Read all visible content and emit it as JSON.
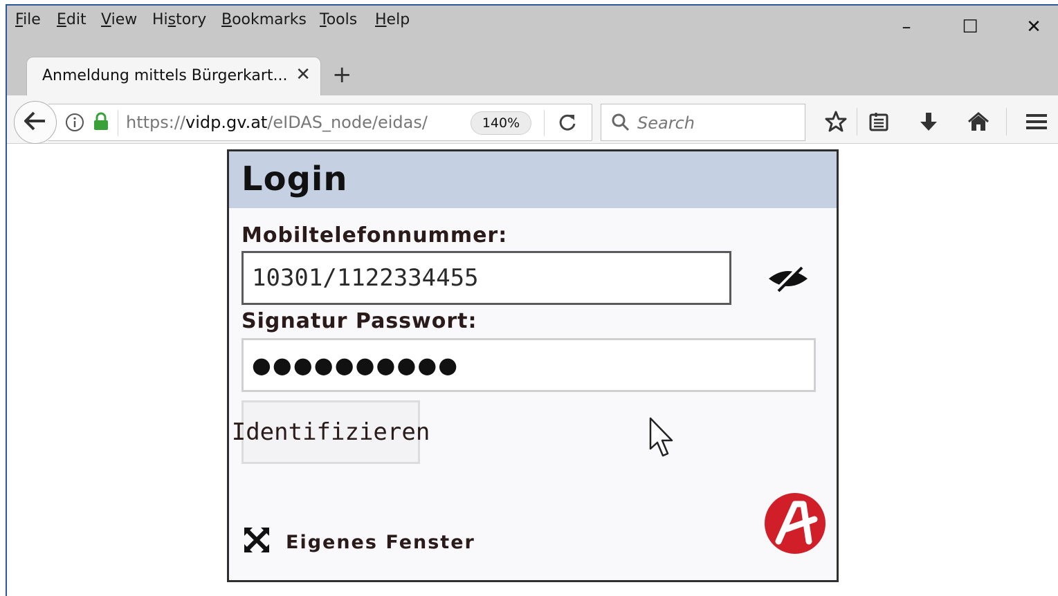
{
  "menubar": {
    "items": [
      {
        "label": "File",
        "accel": "F",
        "rest": "ile"
      },
      {
        "label": "Edit",
        "accel": "E",
        "rest": "dit"
      },
      {
        "label": "View",
        "accel": "V",
        "rest": "iew"
      },
      {
        "label": "History",
        "pre": "Hi",
        "accel": "s",
        "rest": "tory"
      },
      {
        "label": "Bookmarks",
        "accel": "B",
        "rest": "ookmarks"
      },
      {
        "label": "Tools",
        "accel": "T",
        "rest": "ools"
      },
      {
        "label": "Help",
        "accel": "H",
        "rest": "elp"
      }
    ],
    "window_controls": {
      "minimize": "–",
      "maximize": "☐",
      "close": "✕"
    }
  },
  "tab": {
    "title": "Anmeldung mittels Bürgerkart...",
    "close_glyph": "✕",
    "new_tab_glyph": "+"
  },
  "navbar": {
    "url_scheme": "https://",
    "url_host": "vidp.gv.at",
    "url_path": "/eIDAS_node/eidas/",
    "zoom": "140%",
    "search_placeholder": "Search",
    "icons": [
      "back-icon",
      "info-icon",
      "lock-icon",
      "reload-icon",
      "search-icon",
      "star-icon",
      "reading-list-icon",
      "download-icon",
      "home-icon",
      "hamburger-menu-icon"
    ]
  },
  "login": {
    "title": "Login",
    "phone_label": "Mobiltelefonnummer:",
    "phone_value": "10301/1122334455",
    "password_label": "Signatur Passwort:",
    "password_value": "●●●●●●●●●●",
    "submit_label": "Identifizieren",
    "own_window_label": "Eigenes Fenster"
  },
  "colors": {
    "chrome_bg": "#c8c8c8",
    "header_bg": "#c5d1e3",
    "lock_green": "#3aa13a",
    "logo_red": "#d11f2a"
  }
}
